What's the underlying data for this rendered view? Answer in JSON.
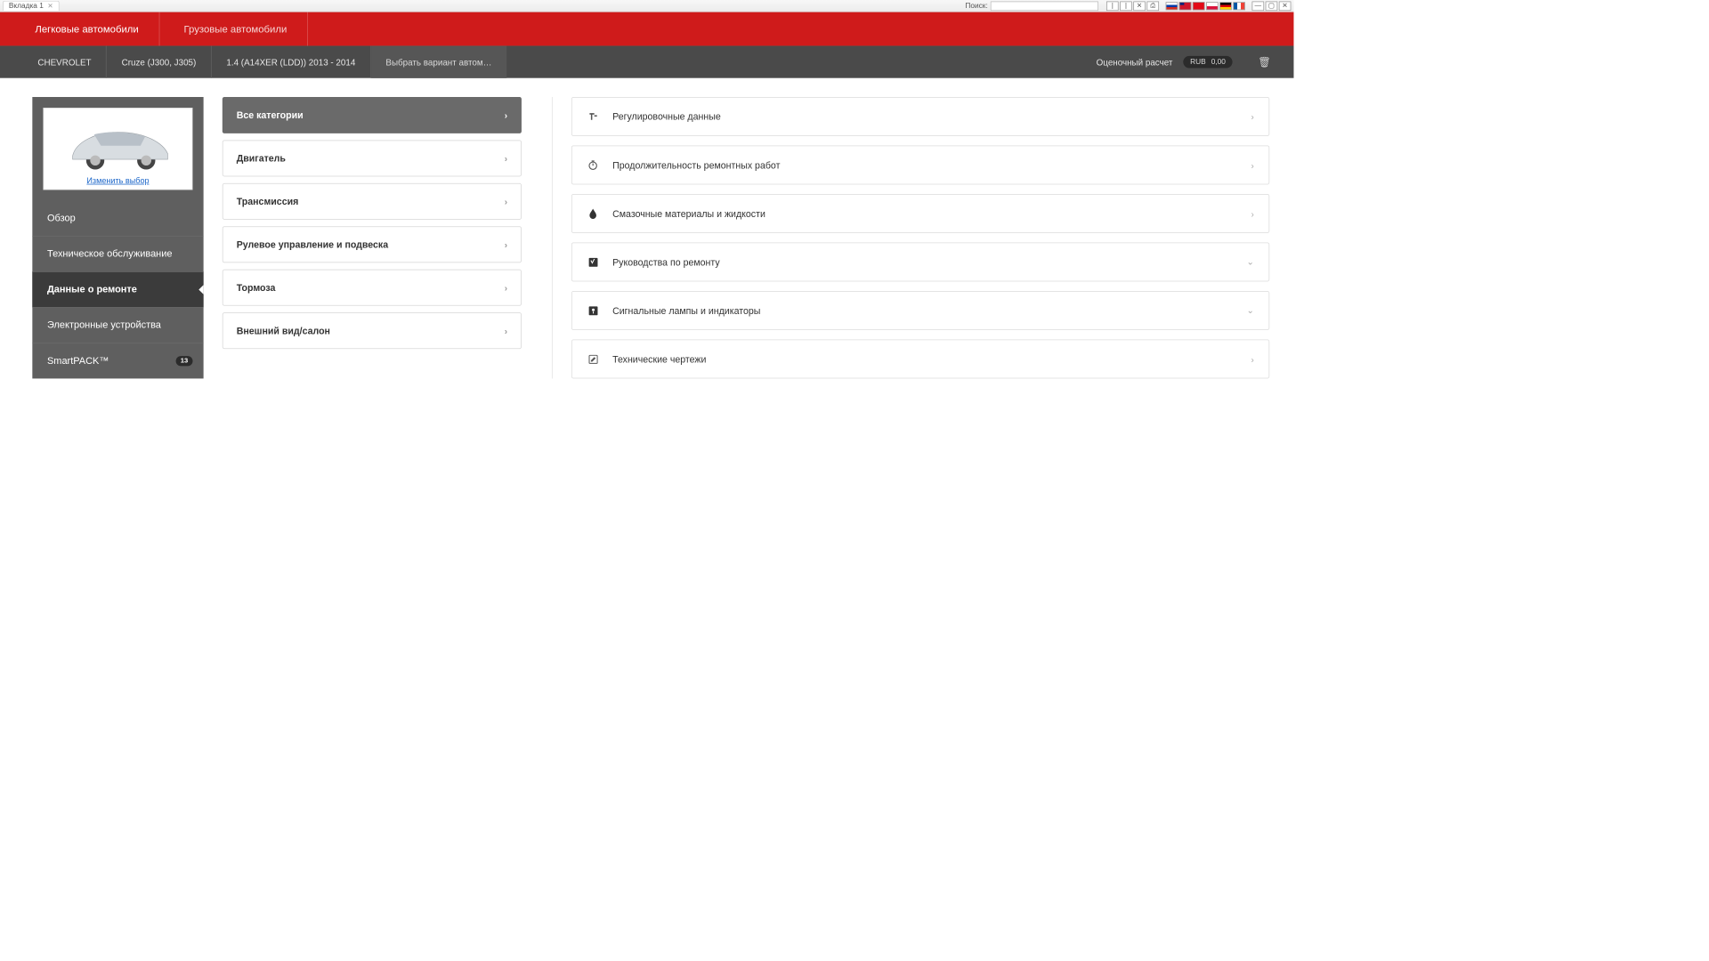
{
  "window": {
    "tab_title": "Вкладка 1",
    "search_label": "Поиск:"
  },
  "header": {
    "tabs": [
      "Легковые автомобили",
      "Грузовые автомобили"
    ]
  },
  "breadcrumb": {
    "brand": "CHEVROLET",
    "model": "Cruze (J300, J305)",
    "engine": "1.4 (A14XER (LDD)) 2013 - 2014",
    "variant": "Выбрать вариант автом…"
  },
  "estimate": {
    "label": "Оценочный расчет",
    "currency": "RUB",
    "amount": "0,00"
  },
  "sidebar": {
    "change_link": "Изменить выбор",
    "items": [
      {
        "label": "Обзор"
      },
      {
        "label": "Техническое обслуживание"
      },
      {
        "label": "Данные о ремонте"
      },
      {
        "label": "Электронные устройства"
      },
      {
        "label": "SmartPACK™",
        "badge": "13"
      }
    ]
  },
  "categories": [
    {
      "label": "Все категории",
      "selected": true
    },
    {
      "label": "Двигатель"
    },
    {
      "label": "Трансмиссия"
    },
    {
      "label": "Рулевое управление и подвеска"
    },
    {
      "label": "Тормоза"
    },
    {
      "label": "Внешний вид/салон"
    }
  ],
  "panels": [
    {
      "icon": "adjust-icon",
      "label": "Регулировочные данные",
      "expand": "right"
    },
    {
      "icon": "timer-icon",
      "label": "Продолжительность ремонтных работ",
      "expand": "right"
    },
    {
      "icon": "drop-icon",
      "label": "Смазочные материалы и жидкости",
      "expand": "right"
    },
    {
      "icon": "manual-icon",
      "label": "Руководства по ремонту",
      "expand": "down"
    },
    {
      "icon": "warning-icon",
      "label": "Сигнальные лампы и индикаторы",
      "expand": "down"
    },
    {
      "icon": "drawing-icon",
      "label": "Технические чертежи",
      "expand": "right"
    }
  ]
}
